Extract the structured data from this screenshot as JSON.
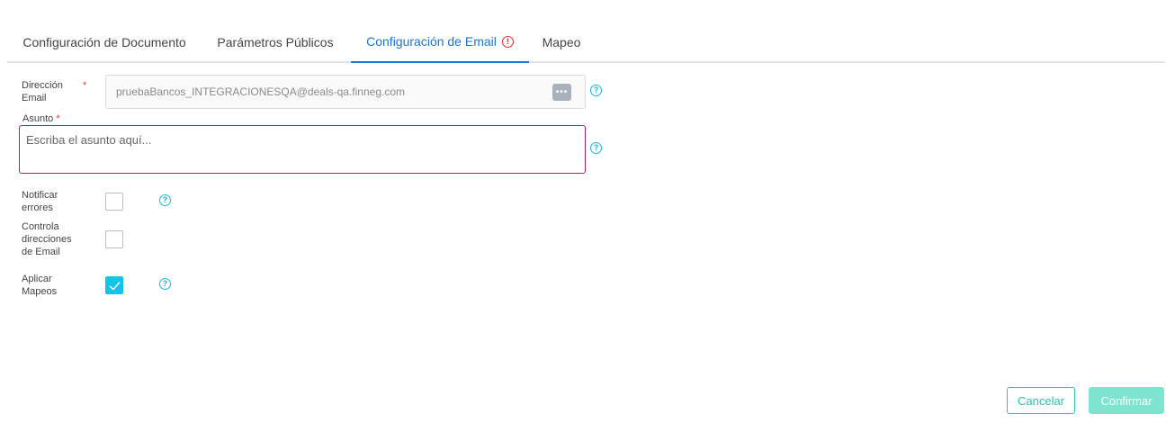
{
  "tabs": [
    {
      "label": "Configuración de Documento"
    },
    {
      "label": "Parámetros Públicos"
    },
    {
      "label": "Configuración de Email"
    },
    {
      "label": "Mapeo"
    }
  ],
  "form": {
    "email_label_1": "Dirección",
    "email_label_2": "Email",
    "required_mark": "*",
    "email_value": "pruebaBancos_INTEGRACIONESQA@deals-qa.finneg.com",
    "more_glyph": "•••",
    "subject_label": "Asunto",
    "subject_placeholder": "Escriba el asunto aquí...",
    "notify_label_1": "Notificar",
    "notify_label_2": "errores",
    "notify_checked": false,
    "control_label_1": "Controla",
    "control_label_2": "direcciones",
    "control_label_3": "de Email",
    "control_checked": false,
    "mapping_label_1": "Aplicar",
    "mapping_label_2": "Mapeos",
    "mapping_checked": true,
    "help_glyph": "?",
    "warn_glyph": "!"
  },
  "actions": {
    "cancel_label": "Cancelar",
    "confirm_label": "Confirmar"
  },
  "colors": {
    "active_tab": "#1976d2",
    "error": "#d32f2f",
    "help": "#1ab8dc",
    "checkbox_checked": "#15c2e8",
    "confirm_bg": "#7ee3cf",
    "cancel_border": "#2ec4a8"
  }
}
